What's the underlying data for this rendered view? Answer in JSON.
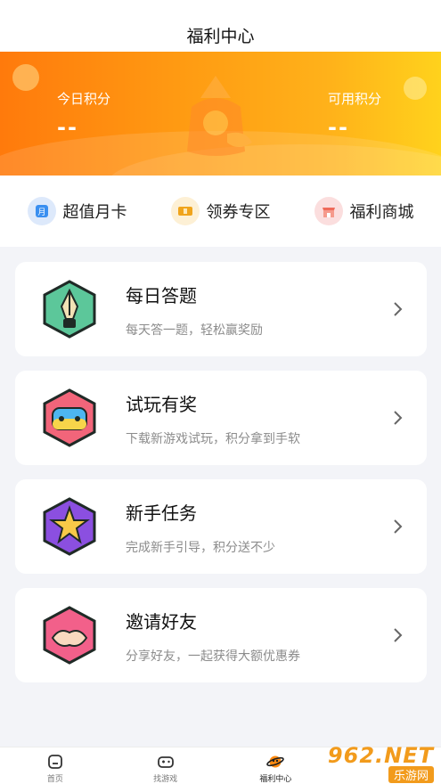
{
  "header": {
    "title": "福利中心"
  },
  "points": {
    "today_label": "今日积分",
    "today_value": "--",
    "available_label": "可用积分",
    "available_value": "--"
  },
  "quick_links": [
    {
      "label": "超值月卡",
      "icon": "monthly-card-icon"
    },
    {
      "label": "领券专区",
      "icon": "coupon-icon"
    },
    {
      "label": "福利商城",
      "icon": "shop-icon"
    }
  ],
  "cards": [
    {
      "title": "每日答题",
      "desc": "每天答一题，轻松赢奖励",
      "icon": "pen-icon"
    },
    {
      "title": "试玩有奖",
      "desc": "下载新游戏试玩，积分拿到手软",
      "icon": "gamepad-icon"
    },
    {
      "title": "新手任务",
      "desc": "完成新手引导，积分送不少",
      "icon": "star-icon"
    },
    {
      "title": "邀请好友",
      "desc": "分享好友，一起获得大额优惠券",
      "icon": "handshake-icon"
    }
  ],
  "tabbar": [
    {
      "label": "首页",
      "icon": "home-icon"
    },
    {
      "label": "找游戏",
      "icon": "gamepad-icon"
    },
    {
      "label": "福利中心",
      "icon": "planet-icon",
      "active": true
    },
    {
      "label": "",
      "icon": ""
    }
  ],
  "watermark": {
    "big": "962.NET",
    "small": "乐游网"
  },
  "colors": {
    "accent": "#ff8a10",
    "banner_end": "#ffd21c",
    "tab_active": "#ff8a10"
  }
}
